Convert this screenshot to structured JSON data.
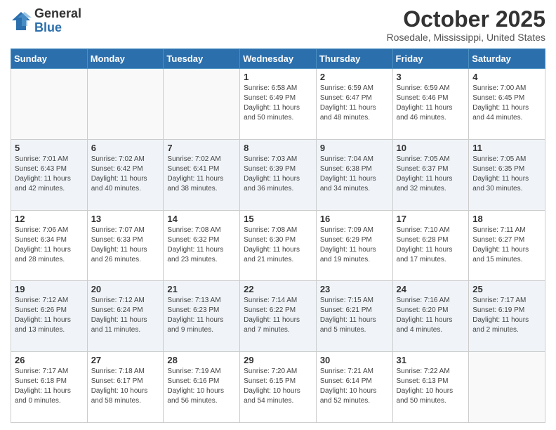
{
  "header": {
    "logo_general": "General",
    "logo_blue": "Blue",
    "month_title": "October 2025",
    "location": "Rosedale, Mississippi, United States"
  },
  "weekdays": [
    "Sunday",
    "Monday",
    "Tuesday",
    "Wednesday",
    "Thursday",
    "Friday",
    "Saturday"
  ],
  "weeks": [
    [
      {
        "day": "",
        "info": ""
      },
      {
        "day": "",
        "info": ""
      },
      {
        "day": "",
        "info": ""
      },
      {
        "day": "1",
        "info": "Sunrise: 6:58 AM\nSunset: 6:49 PM\nDaylight: 11 hours\nand 50 minutes."
      },
      {
        "day": "2",
        "info": "Sunrise: 6:59 AM\nSunset: 6:47 PM\nDaylight: 11 hours\nand 48 minutes."
      },
      {
        "day": "3",
        "info": "Sunrise: 6:59 AM\nSunset: 6:46 PM\nDaylight: 11 hours\nand 46 minutes."
      },
      {
        "day": "4",
        "info": "Sunrise: 7:00 AM\nSunset: 6:45 PM\nDaylight: 11 hours\nand 44 minutes."
      }
    ],
    [
      {
        "day": "5",
        "info": "Sunrise: 7:01 AM\nSunset: 6:43 PM\nDaylight: 11 hours\nand 42 minutes."
      },
      {
        "day": "6",
        "info": "Sunrise: 7:02 AM\nSunset: 6:42 PM\nDaylight: 11 hours\nand 40 minutes."
      },
      {
        "day": "7",
        "info": "Sunrise: 7:02 AM\nSunset: 6:41 PM\nDaylight: 11 hours\nand 38 minutes."
      },
      {
        "day": "8",
        "info": "Sunrise: 7:03 AM\nSunset: 6:39 PM\nDaylight: 11 hours\nand 36 minutes."
      },
      {
        "day": "9",
        "info": "Sunrise: 7:04 AM\nSunset: 6:38 PM\nDaylight: 11 hours\nand 34 minutes."
      },
      {
        "day": "10",
        "info": "Sunrise: 7:05 AM\nSunset: 6:37 PM\nDaylight: 11 hours\nand 32 minutes."
      },
      {
        "day": "11",
        "info": "Sunrise: 7:05 AM\nSunset: 6:35 PM\nDaylight: 11 hours\nand 30 minutes."
      }
    ],
    [
      {
        "day": "12",
        "info": "Sunrise: 7:06 AM\nSunset: 6:34 PM\nDaylight: 11 hours\nand 28 minutes."
      },
      {
        "day": "13",
        "info": "Sunrise: 7:07 AM\nSunset: 6:33 PM\nDaylight: 11 hours\nand 26 minutes."
      },
      {
        "day": "14",
        "info": "Sunrise: 7:08 AM\nSunset: 6:32 PM\nDaylight: 11 hours\nand 23 minutes."
      },
      {
        "day": "15",
        "info": "Sunrise: 7:08 AM\nSunset: 6:30 PM\nDaylight: 11 hours\nand 21 minutes."
      },
      {
        "day": "16",
        "info": "Sunrise: 7:09 AM\nSunset: 6:29 PM\nDaylight: 11 hours\nand 19 minutes."
      },
      {
        "day": "17",
        "info": "Sunrise: 7:10 AM\nSunset: 6:28 PM\nDaylight: 11 hours\nand 17 minutes."
      },
      {
        "day": "18",
        "info": "Sunrise: 7:11 AM\nSunset: 6:27 PM\nDaylight: 11 hours\nand 15 minutes."
      }
    ],
    [
      {
        "day": "19",
        "info": "Sunrise: 7:12 AM\nSunset: 6:26 PM\nDaylight: 11 hours\nand 13 minutes."
      },
      {
        "day": "20",
        "info": "Sunrise: 7:12 AM\nSunset: 6:24 PM\nDaylight: 11 hours\nand 11 minutes."
      },
      {
        "day": "21",
        "info": "Sunrise: 7:13 AM\nSunset: 6:23 PM\nDaylight: 11 hours\nand 9 minutes."
      },
      {
        "day": "22",
        "info": "Sunrise: 7:14 AM\nSunset: 6:22 PM\nDaylight: 11 hours\nand 7 minutes."
      },
      {
        "day": "23",
        "info": "Sunrise: 7:15 AM\nSunset: 6:21 PM\nDaylight: 11 hours\nand 5 minutes."
      },
      {
        "day": "24",
        "info": "Sunrise: 7:16 AM\nSunset: 6:20 PM\nDaylight: 11 hours\nand 4 minutes."
      },
      {
        "day": "25",
        "info": "Sunrise: 7:17 AM\nSunset: 6:19 PM\nDaylight: 11 hours\nand 2 minutes."
      }
    ],
    [
      {
        "day": "26",
        "info": "Sunrise: 7:17 AM\nSunset: 6:18 PM\nDaylight: 11 hours\nand 0 minutes."
      },
      {
        "day": "27",
        "info": "Sunrise: 7:18 AM\nSunset: 6:17 PM\nDaylight: 10 hours\nand 58 minutes."
      },
      {
        "day": "28",
        "info": "Sunrise: 7:19 AM\nSunset: 6:16 PM\nDaylight: 10 hours\nand 56 minutes."
      },
      {
        "day": "29",
        "info": "Sunrise: 7:20 AM\nSunset: 6:15 PM\nDaylight: 10 hours\nand 54 minutes."
      },
      {
        "day": "30",
        "info": "Sunrise: 7:21 AM\nSunset: 6:14 PM\nDaylight: 10 hours\nand 52 minutes."
      },
      {
        "day": "31",
        "info": "Sunrise: 7:22 AM\nSunset: 6:13 PM\nDaylight: 10 hours\nand 50 minutes."
      },
      {
        "day": "",
        "info": ""
      }
    ]
  ]
}
